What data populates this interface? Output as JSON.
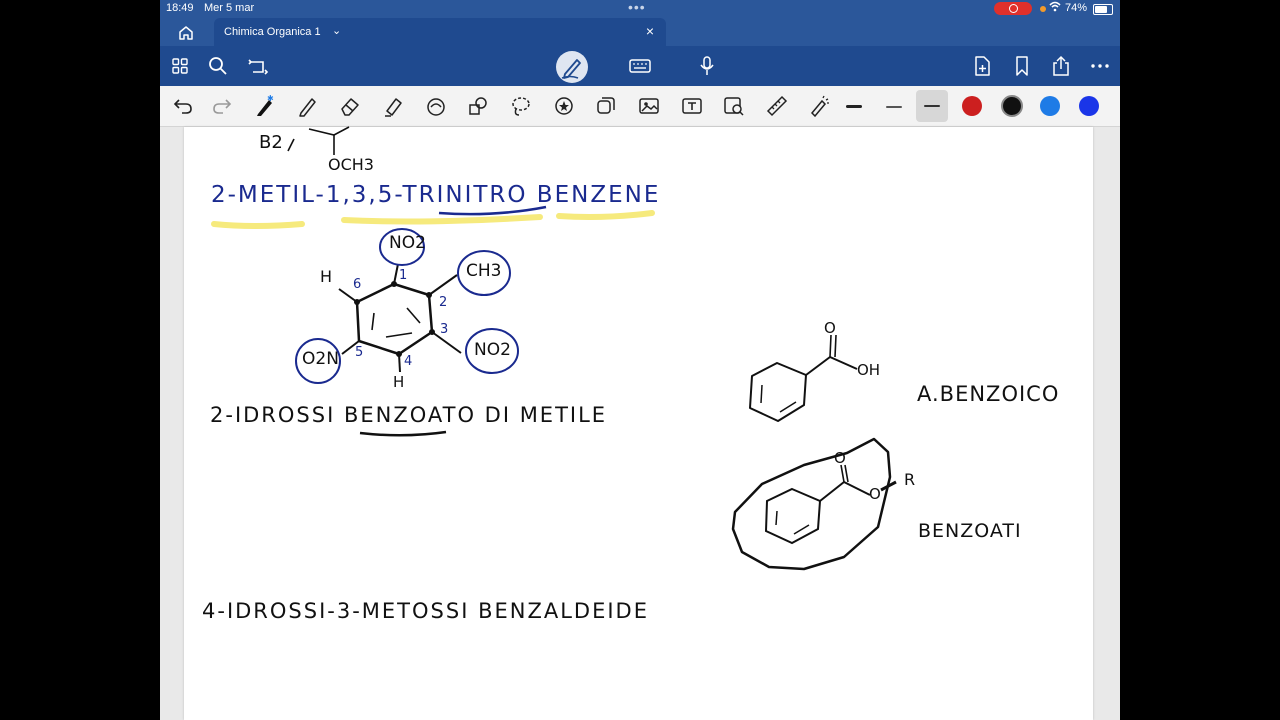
{
  "status": {
    "time": "18:49",
    "date": "Mer 5 mar",
    "battery": "74%"
  },
  "tab": {
    "title": "Chimica Organica 1"
  },
  "icons": {
    "home": "home-icon",
    "apps": "grid-icon",
    "search": "search-icon",
    "sync": "sync-icon",
    "pen_mode": "pen-mode-icon",
    "keyboard": "keyboard-icon",
    "mic": "microphone-icon",
    "add_page": "add-page-icon",
    "bookmark": "bookmark-icon",
    "share": "share-icon",
    "more": "more-icon"
  },
  "draw_colors": [
    "#cc1f1f",
    "#111111",
    "#1e7be6",
    "#1a35e8"
  ],
  "notes": {
    "top_fragment_a": "B2",
    "top_fragment_b": "OCH3",
    "title1": "2-METIL-1,3,5-TRINITRO BENZENE",
    "no2_top": "NO2",
    "ch3": "CH3",
    "no2_right": "NO2",
    "o2n": "O2N",
    "h_top": "H",
    "h_bottom": "H",
    "num1": "1",
    "num2": "2",
    "num3": "3",
    "num4": "4",
    "num5": "5",
    "num6": "6",
    "title2": "2-IDROSSI BENZOATO DI METILE",
    "title3": "4-IDROSSI-3-METOSSI BENZALDEIDE",
    "acid_label": "A.BENZOICO",
    "benzoate_label": "BENZOATI",
    "o": "O",
    "oh": "OH",
    "r": "R"
  }
}
